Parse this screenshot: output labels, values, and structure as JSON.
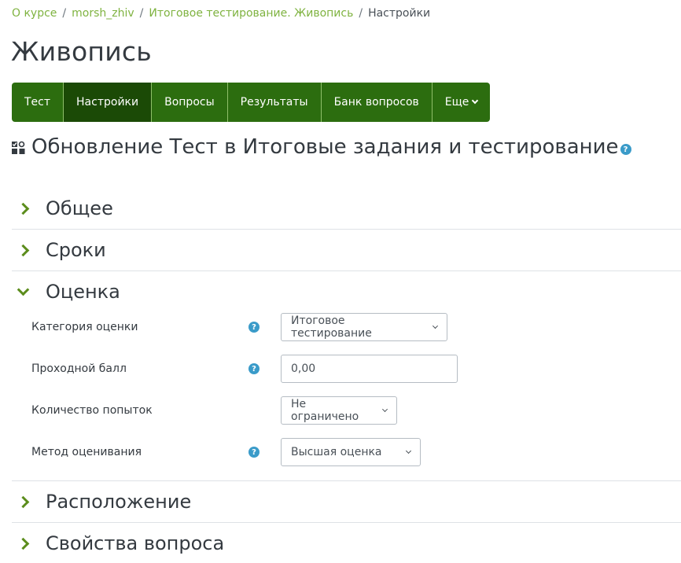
{
  "breadcrumb": {
    "items": [
      "О курсе",
      "morsh_zhiv",
      "Итоговое тестирование. Живопись"
    ],
    "current": "Настройки",
    "separator": "/"
  },
  "page_title": "Живопись",
  "tabs": [
    {
      "label": "Тест"
    },
    {
      "label": "Настройки",
      "active": true
    },
    {
      "label": "Вопросы"
    },
    {
      "label": "Результаты"
    },
    {
      "label": "Банк вопросов"
    },
    {
      "label": "Еще",
      "dropdown": true
    }
  ],
  "heading": "Обновление Тест в Итоговые задания и тестирование",
  "sections": {
    "general": "Общее",
    "timing": "Сроки",
    "grade": "Оценка",
    "layout": "Расположение",
    "question_behaviour": "Свойства вопроса"
  },
  "grade_fields": {
    "category": {
      "label": "Категория оценки",
      "value": "Итоговое тестирование"
    },
    "pass_grade": {
      "label": "Проходной балл",
      "value": "0,00"
    },
    "attempts": {
      "label": "Количество попыток",
      "value": "Не ограничено"
    },
    "method": {
      "label": "Метод оценивания",
      "value": "Высшая оценка"
    }
  },
  "help_glyph": "?",
  "colors": {
    "accent": "#7fb340",
    "nav_bg": "#2c6d0f",
    "nav_active": "#1b4a06",
    "help": "#3a9bc9",
    "chevron": "#5c8d1d"
  }
}
